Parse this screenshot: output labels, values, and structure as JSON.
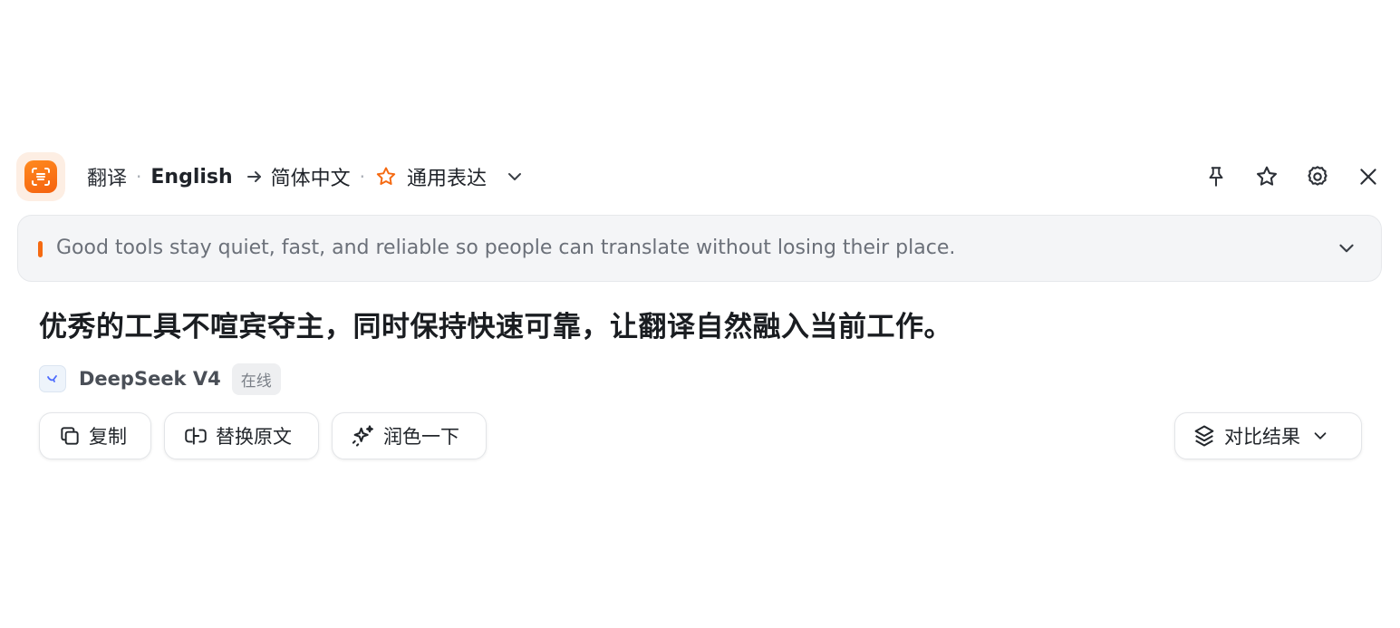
{
  "header": {
    "mode_label": "翻译",
    "separator": "·",
    "source_language": "English",
    "target_language": "简体中文",
    "style_label": "通用表达"
  },
  "source": {
    "text": "Good tools stay quiet, fast, and reliable so people can translate without losing their place."
  },
  "result": {
    "text": "优秀的工具不喧宾夺主，同时保持快速可靠，让翻译自然融入当前工作。",
    "engine_name": "DeepSeek V4",
    "engine_status": "在线"
  },
  "actions": {
    "copy_label": "复制",
    "replace_label": "替换原文",
    "polish_label": "润色一下",
    "compare_label": "对比结果"
  },
  "icons": {
    "app": "scan-translate-icon",
    "arrow": "arrow-right-icon",
    "style": "star-outline-icon",
    "caret": "chevron-down-icon",
    "pin": "pin-icon",
    "favorite": "star-icon",
    "settings": "gear-icon",
    "close": "close-icon",
    "copy": "copy-icon",
    "replace": "replace-icon",
    "polish": "sparkles-icon",
    "compare": "layers-icon"
  },
  "colors": {
    "accent": "#f56a12",
    "text_primary": "#1f2329",
    "text_secondary": "#6b7079",
    "source_bg": "#f4f5f7"
  }
}
